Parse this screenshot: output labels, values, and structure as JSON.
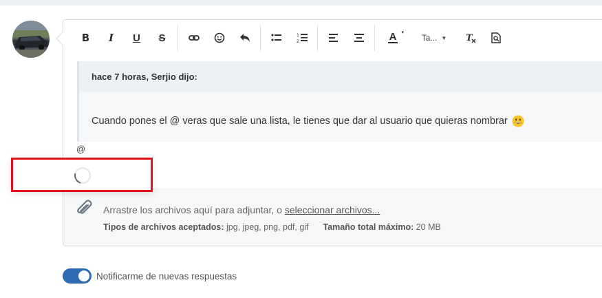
{
  "toolbar": {
    "bold": "B",
    "italic": "I",
    "underline": "U",
    "strike": "S",
    "text_color": "A",
    "font_size": "Ta..."
  },
  "quote": {
    "header": "hace 7 horas, Serjio dijo:",
    "body": "Cuando pones el @ veras que sale una lista, le tienes que dar al usuario que quieras nombrar"
  },
  "editor": {
    "typed_text": "@"
  },
  "attachments": {
    "drop_text": "Arrastre los archivos aquí para adjuntar, o ",
    "select_link": "seleccionar archivos...",
    "types_label": "Tipos de archivos aceptados:",
    "types_value": "jpg, jpeg, png, pdf, gif",
    "max_label": "Tamaño total máximo:",
    "max_value": "20 MB"
  },
  "notify": {
    "label": "Notificarme de nuevas respuestas",
    "on": true
  },
  "colors": {
    "toggle": "#2f6bb5",
    "highlight_border": "#e0121a"
  }
}
